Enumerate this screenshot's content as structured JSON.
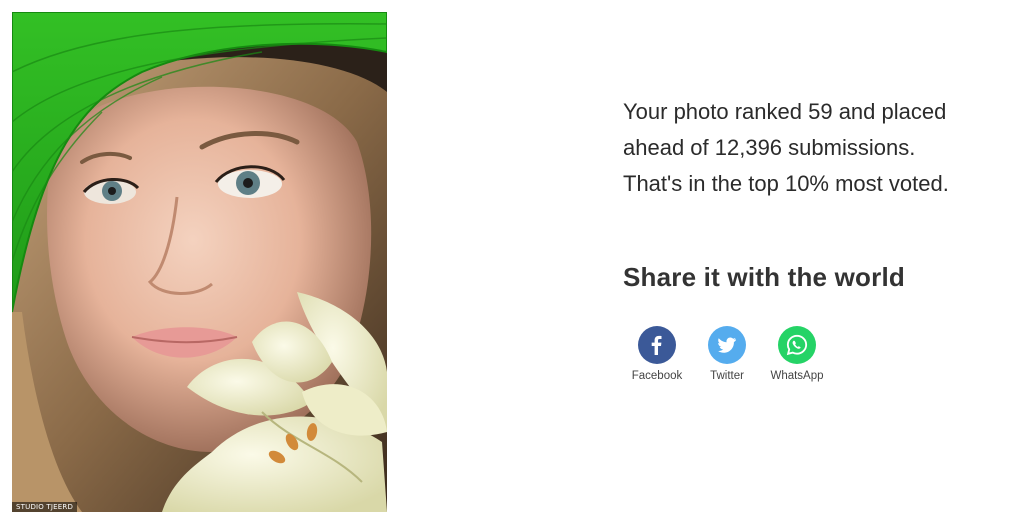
{
  "photo": {
    "watermark": "STUDIO TJEERD"
  },
  "result": {
    "line1": "Your photo ranked 59 and placed",
    "line2": "ahead of 12,396 submissions.",
    "line3": "That's in the top 10% most voted."
  },
  "share": {
    "title": "Share it with the world",
    "buttons": [
      {
        "label": "Facebook",
        "icon": "facebook-icon",
        "color": "#3b5998"
      },
      {
        "label": "Twitter",
        "icon": "twitter-icon",
        "color": "#55acee"
      },
      {
        "label": "WhatsApp",
        "icon": "whatsapp-icon",
        "color": "#25d366"
      }
    ]
  }
}
